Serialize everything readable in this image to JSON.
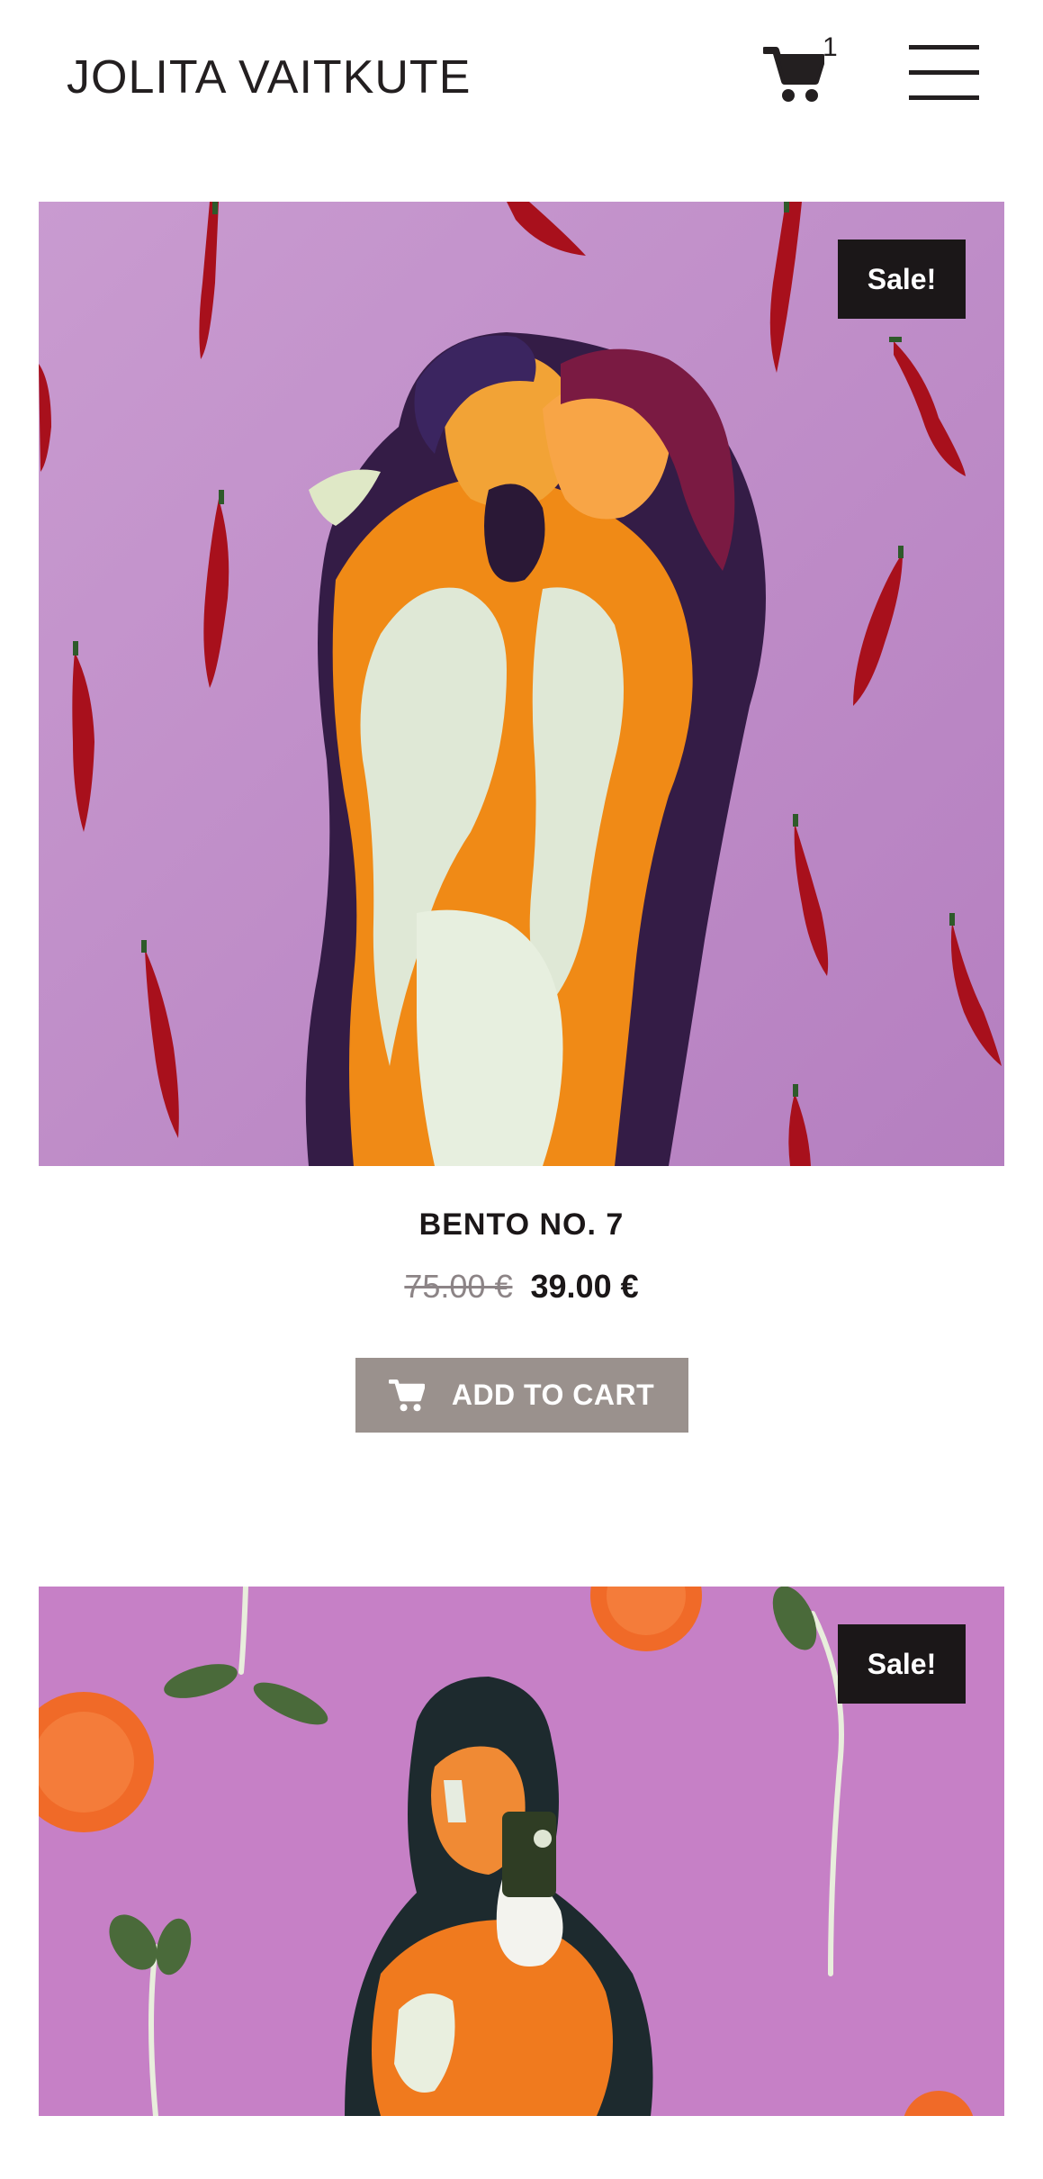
{
  "header": {
    "site_title": "JOLITA VAITKUTE",
    "cart_count": "1",
    "cart_icon": "cart-icon",
    "menu_icon": "hamburger-menu-icon"
  },
  "products": [
    {
      "sale_badge": "Sale!",
      "title": "BENTO NO. 7",
      "price_old": "75.00 €",
      "price_new": "39.00 €",
      "button_label": "ADD TO CART",
      "image_description_icon": "product-image"
    },
    {
      "sale_badge": "Sale!",
      "image_description_icon": "product-image"
    }
  ],
  "colors": {
    "dark": "#1b1718",
    "button_bg": "#9a918d",
    "old_price": "#8c8486",
    "image_bg": "#c892c8"
  }
}
